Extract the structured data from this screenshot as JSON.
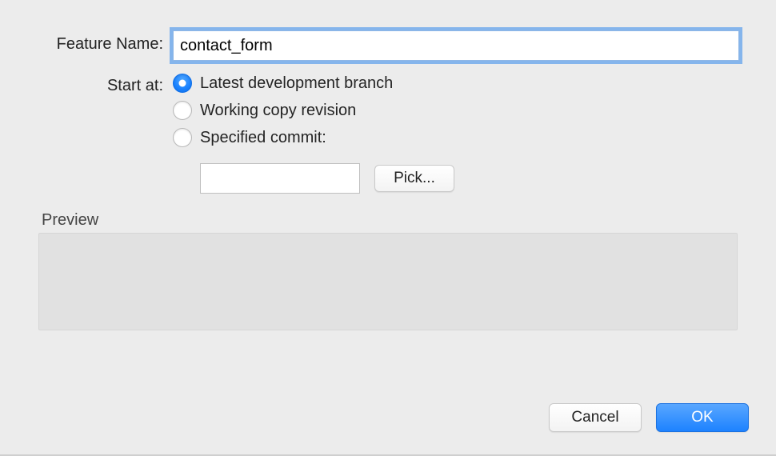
{
  "labels": {
    "feature_name": "Feature Name:",
    "start_at": "Start at:",
    "preview": "Preview"
  },
  "feature_name_value": "contact_form",
  "start_at": {
    "options": [
      {
        "label": "Latest development branch",
        "selected": true
      },
      {
        "label": "Working copy revision",
        "selected": false
      },
      {
        "label": "Specified commit:",
        "selected": false
      }
    ],
    "commit_value": "",
    "pick_label": "Pick..."
  },
  "buttons": {
    "cancel": "Cancel",
    "ok": "OK"
  }
}
